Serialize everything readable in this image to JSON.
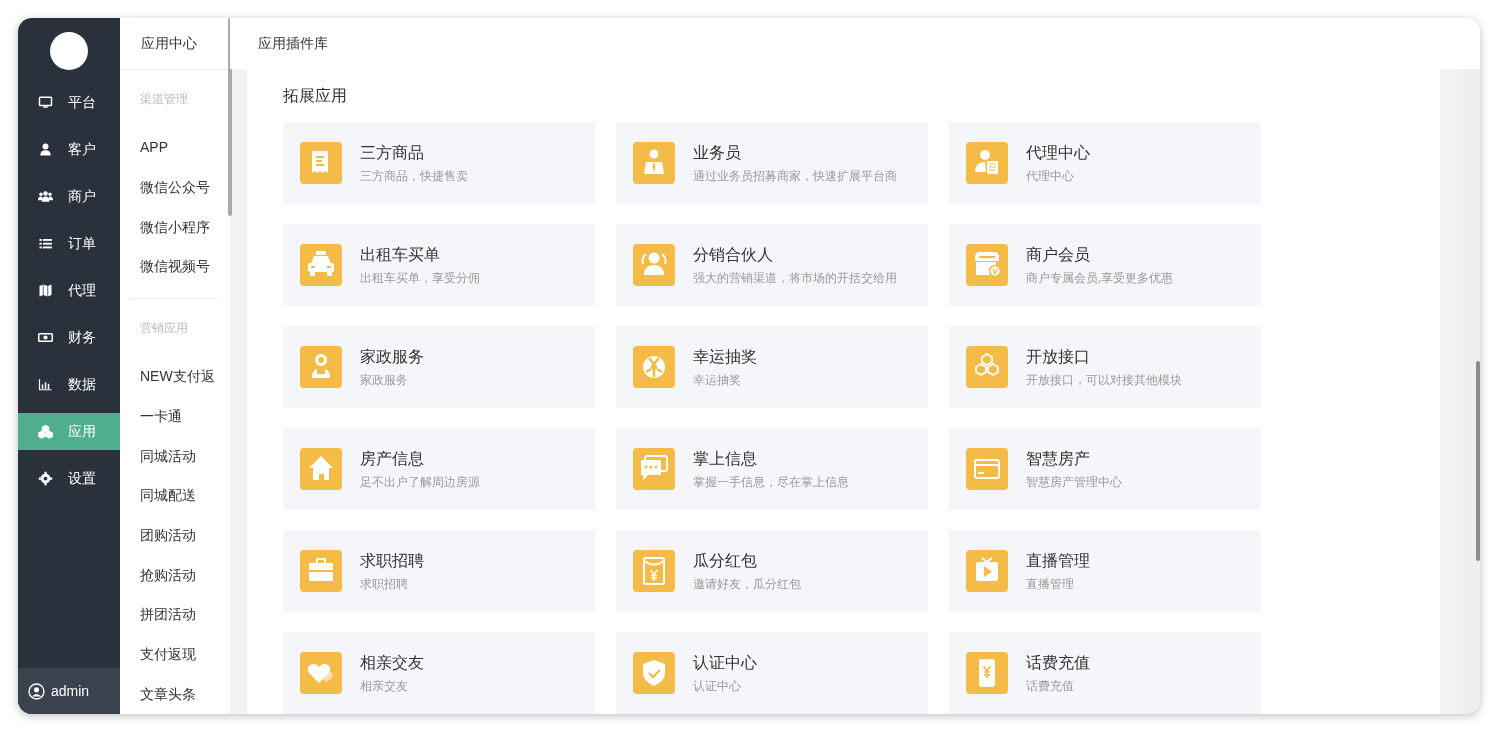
{
  "sidebar": {
    "items": [
      {
        "label": "平台",
        "selected": false
      },
      {
        "label": "客户",
        "selected": false
      },
      {
        "label": "商户",
        "selected": false
      },
      {
        "label": "订单",
        "selected": false
      },
      {
        "label": "代理",
        "selected": false
      },
      {
        "label": "财务",
        "selected": false
      },
      {
        "label": "数据",
        "selected": false
      },
      {
        "label": "应用",
        "selected": true
      },
      {
        "label": "设置",
        "selected": false
      }
    ],
    "user": "admin"
  },
  "submenu": {
    "title": "应用中心",
    "groups": [
      {
        "label": "渠道管理",
        "items": [
          "APP",
          "微信公众号",
          "微信小程序",
          "微信视频号"
        ]
      },
      {
        "label": "营销应用",
        "items": [
          "NEW支付返",
          "一卡通",
          "同城活动",
          "同城配送",
          "团购活动",
          "抢购活动",
          "拼团活动",
          "支付返现",
          "文章头条"
        ]
      }
    ]
  },
  "header": {
    "title": "应用插件库"
  },
  "section": {
    "title": "拓展应用",
    "cards": [
      {
        "title": "三方商品",
        "description": "三方商品，快捷售卖"
      },
      {
        "title": "业务员",
        "description": "通过业务员招募商家，快速扩展平台商"
      },
      {
        "title": "代理中心",
        "description": "代理中心"
      },
      {
        "title": "出租车买单",
        "description": "出租车买单，享受分佣"
      },
      {
        "title": "分销合伙人",
        "description": "强大的营销渠道，将市场的开括交给用"
      },
      {
        "title": "商户会员",
        "description": "商户专属会员,享受更多优惠"
      },
      {
        "title": "家政服务",
        "description": "家政服务"
      },
      {
        "title": "幸运抽奖",
        "description": "幸运抽奖"
      },
      {
        "title": "开放接口",
        "description": "开放接口，可以对接其他模块"
      },
      {
        "title": "房产信息",
        "description": "足不出户了解周边房源"
      },
      {
        "title": "掌上信息",
        "description": "掌握一手信息，尽在掌上信息"
      },
      {
        "title": "智慧房产",
        "description": "智慧房产管理中心"
      },
      {
        "title": "求职招聘",
        "description": "求职招聘"
      },
      {
        "title": "瓜分红包",
        "description": "邀请好友，瓜分红包"
      },
      {
        "title": "直播管理",
        "description": "直播管理"
      },
      {
        "title": "相亲交友",
        "description": "相亲交友"
      },
      {
        "title": "认证中心",
        "description": "认证中心"
      },
      {
        "title": "话费充值",
        "description": "话费充值"
      }
    ]
  }
}
